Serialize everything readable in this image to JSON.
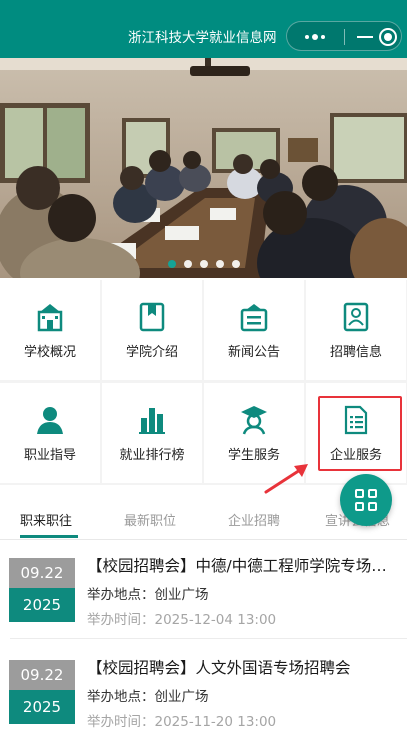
{
  "header": {
    "title": "浙江科技大学就业信息网"
  },
  "banner": {
    "slide_count": 5,
    "active_index": 0
  },
  "colors": {
    "brand": "#008c80",
    "accent": "#0e8a7e",
    "highlight": "#e8333a"
  },
  "menu": {
    "row1": [
      {
        "label": "学校概况",
        "icon": "school-building-icon"
      },
      {
        "label": "学院介绍",
        "icon": "book-icon"
      },
      {
        "label": "新闻公告",
        "icon": "news-board-icon"
      },
      {
        "label": "招聘信息",
        "icon": "resume-icon"
      }
    ],
    "row2": [
      {
        "label": "职业指导",
        "icon": "person-icon"
      },
      {
        "label": "就业排行榜",
        "icon": "bar-chart-icon"
      },
      {
        "label": "学生服务",
        "icon": "graduate-icon"
      },
      {
        "label": "企业服务",
        "icon": "document-list-icon"
      }
    ]
  },
  "tabs": [
    "职来职往",
    "最新职位",
    "企业招聘",
    "宣讲会信息"
  ],
  "list": [
    {
      "month_day": "09.22",
      "year": "2025",
      "title": "【校园招聘会】中德/中德工程师学院专场招聘会",
      "location": "举办地点：创业广场",
      "time": "举办时间：2025-12-04 13:00"
    },
    {
      "month_day": "09.22",
      "year": "2025",
      "title": "【校园招聘会】人文外国语专场招聘会",
      "location": "举办地点：创业广场",
      "time": "举办时间：2025-11-20 13:00"
    }
  ]
}
